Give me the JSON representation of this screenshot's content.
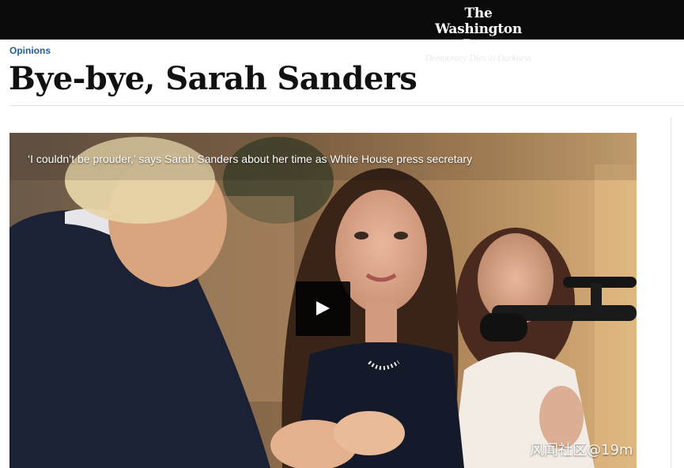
{
  "masthead": {
    "logo_name": "The Washington Post",
    "tagline": "Democracy Dies in Darkness"
  },
  "article": {
    "section": "Opinions",
    "headline": "Bye-bye, Sarah Sanders"
  },
  "video": {
    "caption": "‘I couldn’t be prouder,’ says Sarah Sanders about her time as White House press secretary",
    "play_icon": "play-icon"
  },
  "watermark": {
    "text": "风闻社区@19m"
  },
  "colors": {
    "masthead_bg": "#0b0b0b",
    "section_link": "#1f5f9a",
    "headline": "#111111"
  }
}
